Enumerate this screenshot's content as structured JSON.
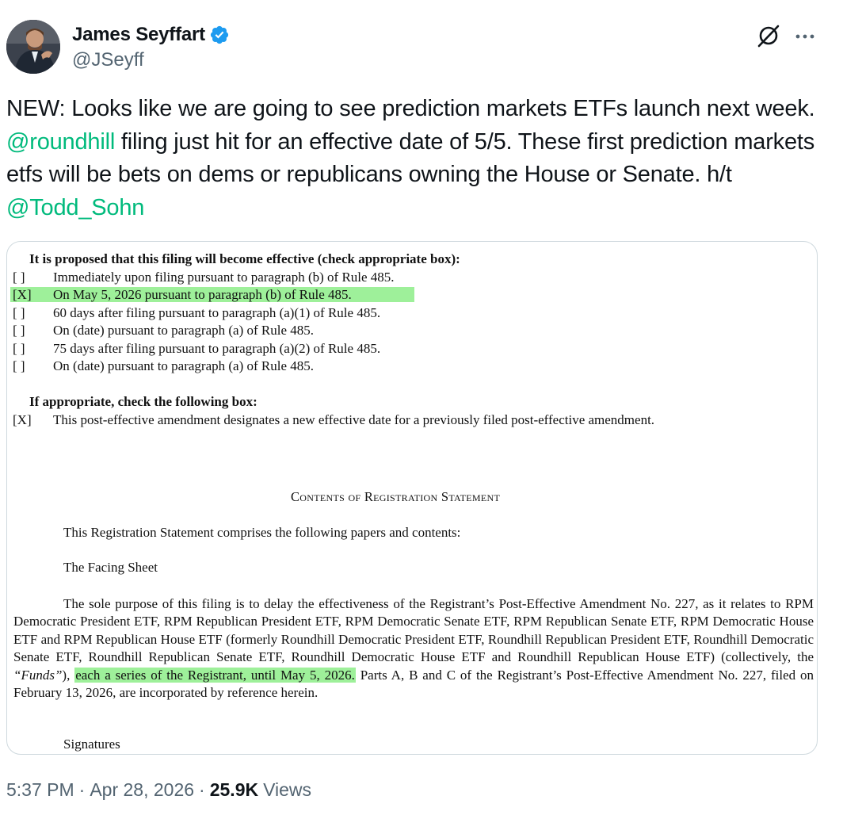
{
  "author": {
    "display_name": "James Seyffart",
    "handle": "@JSeyff",
    "verified": true,
    "verified_color": "#1d9bf0"
  },
  "header_icons": {
    "grok": "grok-icon",
    "more": "more-icon"
  },
  "tweet": {
    "text_1": "NEW: Looks like we are going to see prediction markets ETFs launch next week. ",
    "mention_1": "@roundhill",
    "text_2": " filing just hit for an effective date of 5/5. These first prediction markets etfs will be bets on dems or republicans owning the House or Senate. h/t ",
    "mention_2": "@Todd_Sohn",
    "mention_color": "#00ba7c"
  },
  "document": {
    "heading_1": "It is proposed that this filing will become effective (check appropriate box):",
    "options": [
      {
        "box": "[  ]",
        "text": "Immediately upon filing pursuant to paragraph (b) of Rule 485."
      },
      {
        "box": "[X]",
        "text": "On May 5, 2026 pursuant to paragraph (b) of Rule 485."
      },
      {
        "box": "[  ]",
        "text": "60 days after filing pursuant to paragraph (a)(1) of Rule 485."
      },
      {
        "box": "[  ]",
        "text": "On (date) pursuant to paragraph (a) of Rule 485."
      },
      {
        "box": "[  ]",
        "text": "75 days after filing pursuant to paragraph (a)(2) of Rule 485."
      },
      {
        "box": "[  ]",
        "text": "On (date) pursuant to paragraph (a) of Rule 485."
      }
    ],
    "heading_2": "If appropriate, check the following box:",
    "amend_box": "[X]",
    "amend_text": "This post-effective amendment designates a new effective date for a previously filed post-effective amendment.",
    "contents_title": "Contents of Registration Statement",
    "comprises": "This Registration Statement comprises the following papers and contents:",
    "facing_sheet": "The Facing Sheet",
    "para_1": "The sole purpose of this filing is to delay the effectiveness of the Registrant’s Post-Effective Amendment No. 227, as it relates to RPM Democratic President ETF, RPM Republican President ETF, RPM Democratic Senate ETF, RPM Republican Senate ETF, RPM Democratic House ETF and RPM Republican House ETF (formerly Roundhill Democratic President ETF, Roundhill Republican President ETF, Roundhill Democratic Senate ETF, Roundhill Republican Senate ETF, Roundhill Democratic House ETF and Roundhill Republican House ETF) (collectively, the ",
    "para_funds": "“Funds”",
    "para_2": "), ",
    "para_highlight": "each a series of the Registrant, until May 5, 2026.",
    "para_3": " Parts A, B and C of the Registrant’s Post-Effective Amendment No. 227, filed on February 13, 2026, are incorporated by reference herein.",
    "signatures": "Signatures",
    "highlight_color": "#9ef09a"
  },
  "footer": {
    "time": "5:37 PM",
    "dot_1": "·",
    "date": "Apr 28, 2026",
    "dot_2": "·",
    "views_count": "25.9K",
    "views_label": "Views"
  }
}
